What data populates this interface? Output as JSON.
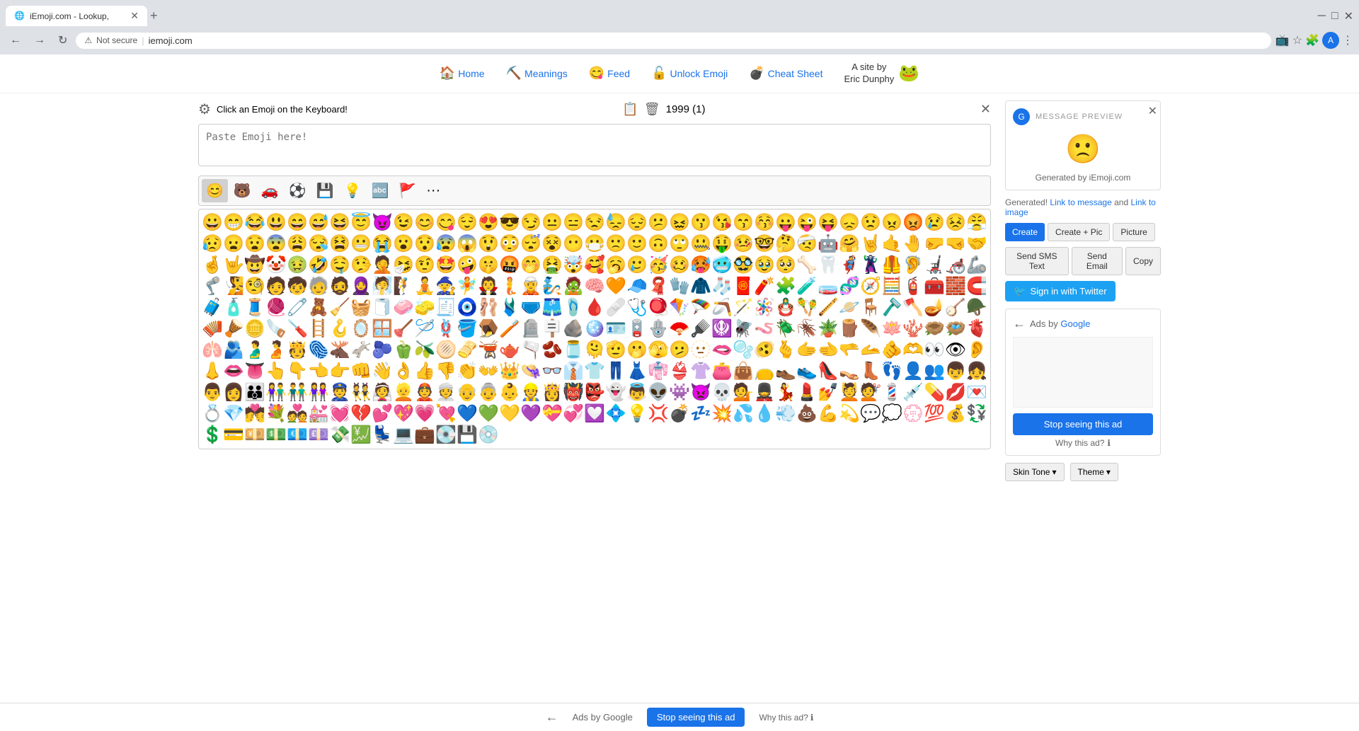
{
  "browser": {
    "tab_title": "iEmoji.com - Lookup,",
    "url": "iemoji.com",
    "security_label": "Not secure"
  },
  "nav": {
    "home_label": "Home",
    "meanings_label": "Meanings",
    "feed_label": "Feed",
    "unlock_emoji_label": "Unlock Emoji",
    "cheat_sheet_label": "Cheat Sheet",
    "site_by_label": "A site by\nEric Dunphy"
  },
  "emoji_panel": {
    "header_title": "Click an Emoji on the Keyboard!",
    "paste_placeholder": "Paste Emoji here!",
    "count": "1999 (1)",
    "categories": [
      "😊",
      "🐻",
      "🚗",
      "⚽",
      "💾",
      "💡",
      "🔤",
      "🚩",
      "•••"
    ]
  },
  "right_panel": {
    "preview_title": "MESSAGE PREVIEW",
    "preview_emoji": "🙁",
    "generated_by": "Generated by iEmoji.com",
    "generated_text": "Generated!",
    "link_to_message": "Link to message",
    "and_text": "and",
    "link_to_image": "Link to image",
    "btn_create": "Create",
    "btn_create_pic": "Create + Pic",
    "btn_picture": "Picture",
    "btn_sms": "Send SMS Text",
    "btn_email": "Send Email",
    "btn_copy": "Copy",
    "twitter_label": "Sign in with Twitter",
    "ads_by": "Ads by",
    "google": "Google",
    "stop_ad_btn": "Stop seeing this ad",
    "why_ad": "Why this ad?",
    "skin_tone_btn": "Skin Tone",
    "theme_btn": "Theme"
  },
  "bottom_ad": {
    "ads_by_label": "Ads by Google",
    "stop_ad_label": "Stop seeing this ad",
    "why_ad_label": "Why this ad?"
  },
  "emojis": [
    "😀",
    "😁",
    "😂",
    "😃",
    "😄",
    "😅",
    "😆",
    "😇",
    "😈",
    "😉",
    "😊",
    "😋",
    "😌",
    "😍",
    "😎",
    "😏",
    "😐",
    "😑",
    "😒",
    "😓",
    "😔",
    "😕",
    "😖",
    "😗",
    "😘",
    "😙",
    "😚",
    "😛",
    "😜",
    "😝",
    "😞",
    "😟",
    "😠",
    "😡",
    "😢",
    "😣",
    "😤",
    "😥",
    "😦",
    "😧",
    "😨",
    "😩",
    "😪",
    "😫",
    "😬",
    "😭",
    "😮",
    "😯",
    "😰",
    "😱",
    "😲",
    "😳",
    "😴",
    "😵",
    "😶",
    "😷",
    "🙁",
    "🙂",
    "🙃",
    "🙄",
    "🤐",
    "🤑",
    "🤒",
    "🤓",
    "🤔",
    "🤕",
    "🤖",
    "🤗",
    "🤘",
    "🤙",
    "🤚",
    "🤛",
    "🤜",
    "🤝",
    "🤞",
    "🤟",
    "🤠",
    "🤡",
    "🤢",
    "🤣",
    "🤤",
    "🤥",
    "🤦",
    "🤧",
    "🤨",
    "🤩",
    "🤪",
    "🤫",
    "🤬",
    "🤭",
    "🤮",
    "🤯",
    "🥰",
    "🥱",
    "🥲",
    "🥳",
    "🥴",
    "🥵",
    "🥶",
    "🥸",
    "🥹",
    "🥺",
    "🦴",
    "🦷",
    "🦸",
    "🦹",
    "🦺",
    "🦻",
    "🦼",
    "🦽",
    "🦾",
    "🦿",
    "🧏",
    "🧐",
    "🧑",
    "🧒",
    "🧓",
    "🧔",
    "🧕",
    "🧖",
    "🧗",
    "🧘",
    "🧙",
    "🧚",
    "🧛",
    "🧜",
    "🧝",
    "🧞",
    "🧟",
    "🧠",
    "🧡",
    "🧢",
    "🧣",
    "🧤",
    "🧥",
    "🧦",
    "🧧",
    "🧨",
    "🧩",
    "🧪",
    "🧫",
    "🧬",
    "🧭",
    "🧮",
    "🧯",
    "🧰",
    "🧱",
    "🧲",
    "🧳",
    "🧴",
    "🧵",
    "🧶",
    "🧷",
    "🧸",
    "🧹",
    "🧺",
    "🧻",
    "🧼",
    "🧽",
    "🧾",
    "🧿",
    "🩰",
    "🩱",
    "🩲",
    "🩳",
    "🩴",
    "🩸",
    "🩹",
    "🩺",
    "🪀",
    "🪁",
    "🪂",
    "🪃",
    "🪄",
    "🪅",
    "🪆",
    "🪇",
    "🪈",
    "🪐",
    "🪑",
    "🪒",
    "🪓",
    "🪔",
    "🪕",
    "🪖",
    "🪗",
    "🪘",
    "🪙",
    "🪚",
    "🪛",
    "🪜",
    "🪝",
    "🪞",
    "🪟",
    "🪠",
    "🪡",
    "🪢",
    "🪣",
    "🪤",
    "🪥",
    "🪦",
    "🪧",
    "🪨",
    "🪩",
    "🪪",
    "🪫",
    "🪬",
    "🪭",
    "🪮",
    "🪯",
    "🪰",
    "🪱",
    "🪲",
    "🪳",
    "🪴",
    "🪵",
    "🪶",
    "🪷",
    "🪸",
    "🪹",
    "🪺",
    "🫀",
    "🫁",
    "🫂",
    "🫃",
    "🫄",
    "🫅",
    "🫆",
    "🫎",
    "🫏",
    "🫐",
    "🫑",
    "🫒",
    "🫓",
    "🫔",
    "🫕",
    "🫖",
    "🫗",
    "🫘",
    "🫙",
    "🫠",
    "🫡",
    "🫢",
    "🫣",
    "🫤",
    "🫥",
    "🫦",
    "🫧",
    "🫨",
    "🫰",
    "🫱",
    "🫲",
    "🫳",
    "🫴",
    "🫵",
    "🫶",
    "👀",
    "👁",
    "👂",
    "👃",
    "👄",
    "👅",
    "👆",
    "👇",
    "👈",
    "👉",
    "👊",
    "👋",
    "👌",
    "👍",
    "👎",
    "👏",
    "👐",
    "👑",
    "👒",
    "👓",
    "👔",
    "👕",
    "👖",
    "👗",
    "👘",
    "👙",
    "👚",
    "👛",
    "👜",
    "👝",
    "👞",
    "👟",
    "👠",
    "👡",
    "👢",
    "👣",
    "👤",
    "👥",
    "👦",
    "👧",
    "👨",
    "👩",
    "👪",
    "👫",
    "👬",
    "👭",
    "👮",
    "👯",
    "👰",
    "👱",
    "👲",
    "👳",
    "👴",
    "👵",
    "👶",
    "👷",
    "👸",
    "👹",
    "👺",
    "👻",
    "👼",
    "👽",
    "👾",
    "👿",
    "💀",
    "💁",
    "💂",
    "💃",
    "💄",
    "💅",
    "💆",
    "💇",
    "💈",
    "💉",
    "💊",
    "💋",
    "💌",
    "💍",
    "💎",
    "💏",
    "💐",
    "💑",
    "💒",
    "💓",
    "💔",
    "💕",
    "💖",
    "💗",
    "💘",
    "💙",
    "💚",
    "💛",
    "💜",
    "💝",
    "💞",
    "💟",
    "💠",
    "💡",
    "💢",
    "💣",
    "💤",
    "💥",
    "💦",
    "💧",
    "💨",
    "💩",
    "💪",
    "💫",
    "💬",
    "💭",
    "💮",
    "💯",
    "💰",
    "💱",
    "💲",
    "💳",
    "💴",
    "💵",
    "💶",
    "💷",
    "💸",
    "💹",
    "💺",
    "💻",
    "💼",
    "💽",
    "💾",
    "💿"
  ]
}
